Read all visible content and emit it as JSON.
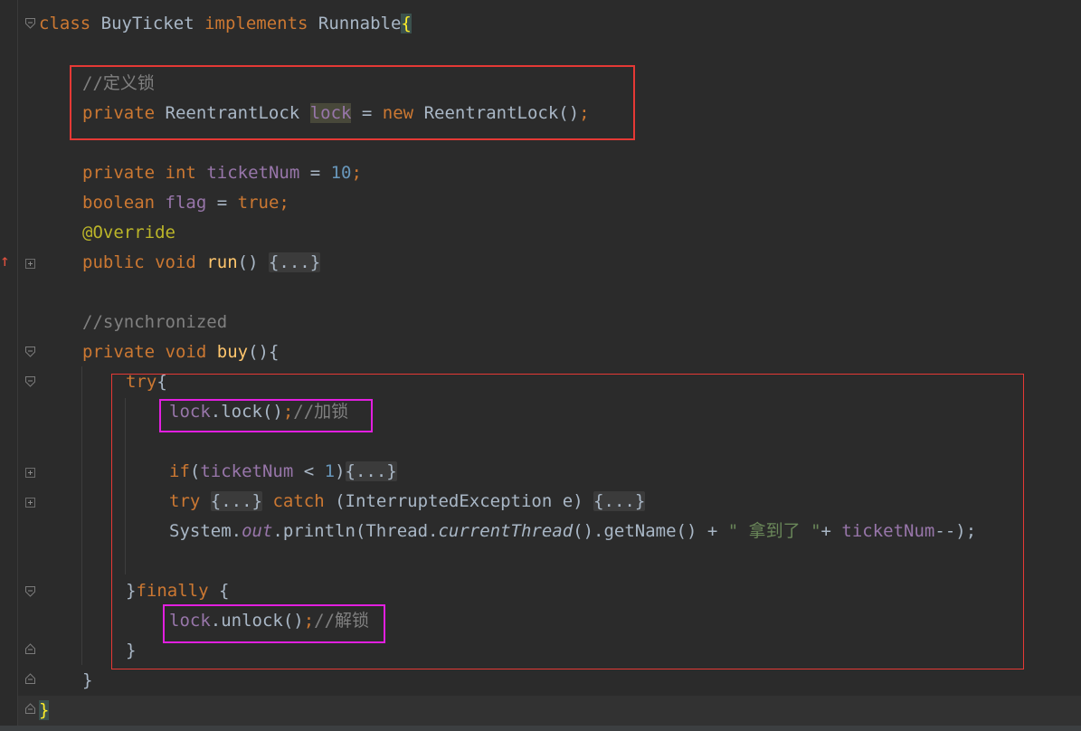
{
  "code": {
    "l1": {
      "kw_class": "class",
      "name": "BuyTicket",
      "kw_impl": "implements",
      "iface": "Runnable",
      "brace": "{"
    },
    "l2": {
      "comment": "//定义锁"
    },
    "l3": {
      "kw": "private",
      "type": "ReentrantLock",
      "field": "lock",
      "eq": " = ",
      "kw_new": "new",
      "ctor": "ReentrantLock()",
      "semi": ";"
    },
    "l4": {
      "kw": "private",
      "kw_int": "int",
      "field": "ticketNum",
      "eq": " = ",
      "num": "10",
      "semi": ";"
    },
    "l5": {
      "kw": "boolean",
      "field": "flag",
      "eq": " = ",
      "val": "true",
      "semi": ";"
    },
    "l6": {
      "ann": "@Override"
    },
    "l7": {
      "kw": "public",
      "kw_void": "void",
      "fn": "run",
      "paren": "() ",
      "folded": "{...}"
    },
    "l8": {
      "comment": "//synchronized"
    },
    "l9": {
      "kw": "private",
      "kw_void": "void",
      "fn": "buy",
      "rest": "(){"
    },
    "l10": {
      "kw": "try",
      "brace": "{"
    },
    "l11": {
      "field": "lock",
      "call": ".lock()",
      "semi": ";",
      "comment": "//加锁"
    },
    "l12": {
      "kw": "if",
      "open": "(",
      "field": "ticketNum",
      "op": " < ",
      "num": "1",
      "close": ")",
      "folded": "{...}"
    },
    "l13": {
      "kw": "try",
      "folded1": "{...}",
      "kw_catch": "catch",
      "params": "(InterruptedException e)",
      "folded2": "{...}"
    },
    "l14": {
      "cls": "System",
      "dot": ".",
      "field": "out",
      "p1": ".println(Thread.",
      "method": "currentThread",
      "p2": "().getName() + ",
      "str": "\" 拿到了 \"",
      "plus": "+ ",
      "field2": "ticketNum",
      "end": "--);"
    },
    "l15": {
      "close": "}",
      "kw": "finally",
      "brace": " {"
    },
    "l16": {
      "field": "lock",
      "call": ".unlock()",
      "semi": ";",
      "comment": "//解锁"
    },
    "l17": {
      "brace": "}"
    },
    "l18": {
      "brace": "}"
    },
    "l19": {
      "brace": "}"
    }
  },
  "gutter": {
    "override_marker": "↑"
  }
}
